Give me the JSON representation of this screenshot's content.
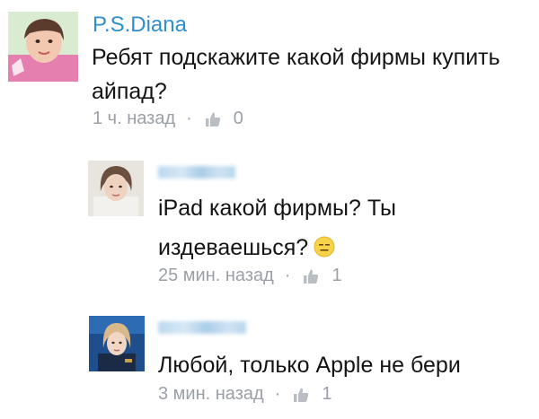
{
  "comments": [
    {
      "author": "P.S.Diana",
      "text": "Ребят подскажите какой фирмы купить айпад?",
      "time": "1 ч. назад",
      "separator": "·",
      "likes": "0",
      "author_blurred": false
    },
    {
      "author": "",
      "text": "iPad какой фирмы? Ты издеваешься?",
      "emoji": "expressionless-face",
      "time": "25 мин. назад",
      "separator": "·",
      "likes": "1",
      "author_blurred": true
    },
    {
      "author": "",
      "text": "Любой, только Apple не бери",
      "time": "3 мин. назад",
      "separator": "·",
      "likes": "1",
      "author_blurred": true
    }
  ],
  "colors": {
    "author_link": "#2f8fcd",
    "meta_gray": "#9aa0a6",
    "text": "#141414"
  },
  "icons": {
    "like": "thumbs-up-icon"
  }
}
